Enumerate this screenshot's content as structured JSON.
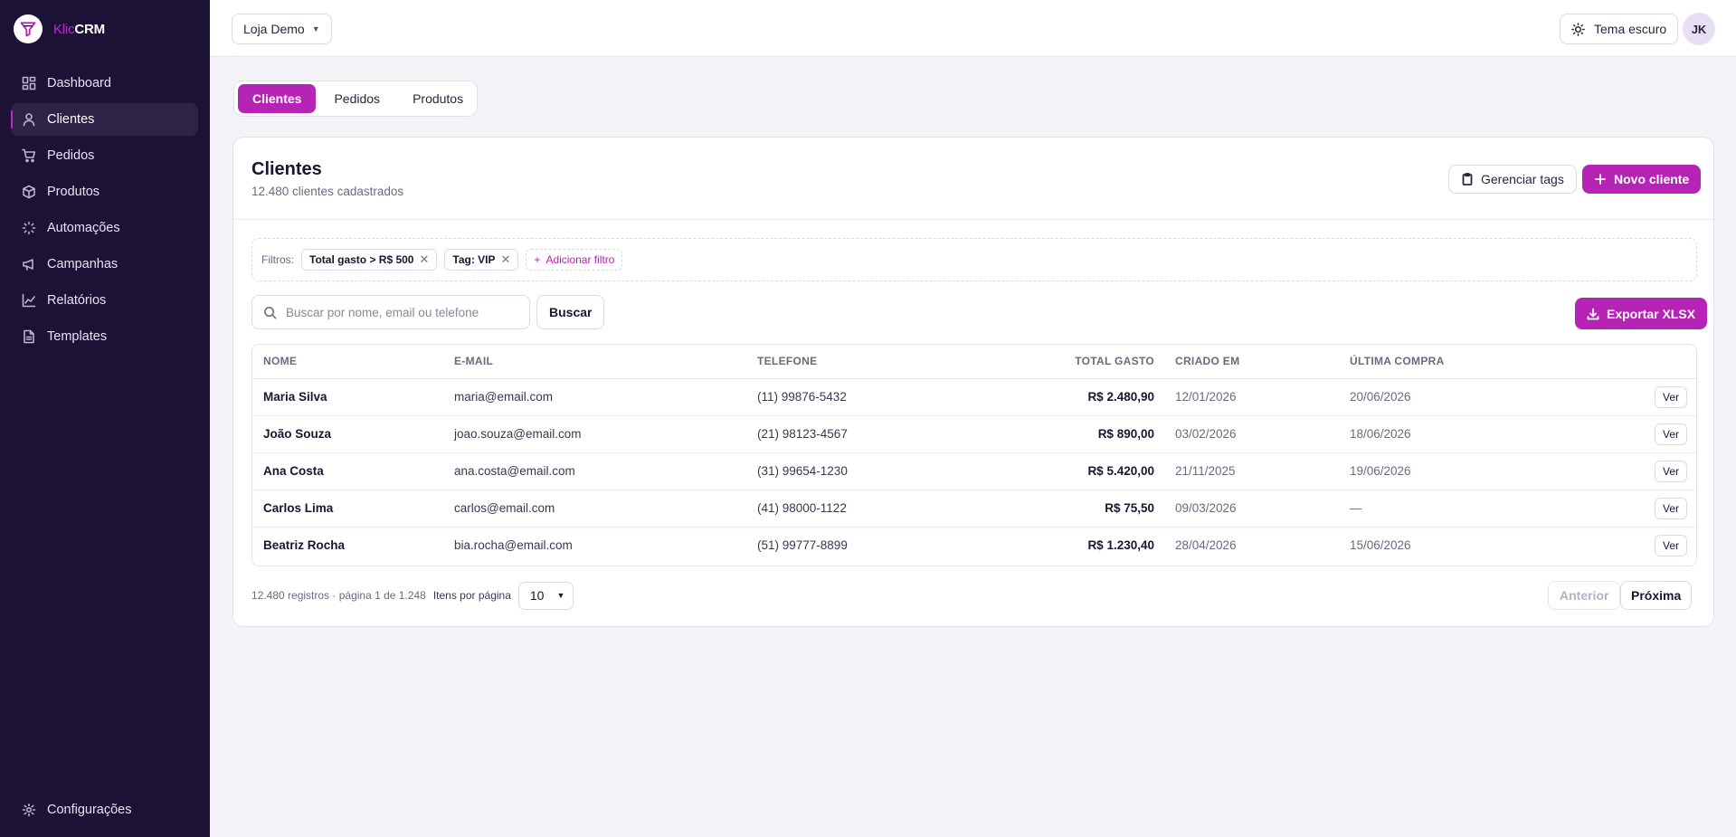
{
  "brand": {
    "prefix": "Klic",
    "suffix": "CRM"
  },
  "sidebar": {
    "items": [
      {
        "label": "Dashboard",
        "icon": "dashboard-icon"
      },
      {
        "label": "Clientes",
        "icon": "users-icon",
        "active": true
      },
      {
        "label": "Pedidos",
        "icon": "cart-icon"
      },
      {
        "label": "Produtos",
        "icon": "box-icon"
      },
      {
        "label": "Automações",
        "icon": "loader-icon"
      },
      {
        "label": "Campanhas",
        "icon": "megaphone-icon"
      },
      {
        "label": "Relatórios",
        "icon": "chart-icon"
      },
      {
        "label": "Templates",
        "icon": "file-icon"
      }
    ],
    "settings_label": "Configurações"
  },
  "topbar": {
    "store": "Loja Demo",
    "theme_label": "Tema escuro",
    "avatar_initials": "JK"
  },
  "tabs": [
    "Clientes",
    "Pedidos",
    "Produtos"
  ],
  "card": {
    "title": "Clientes",
    "subtitle": "12.480 clientes cadastrados",
    "manage_tags": "Gerenciar tags",
    "new_client": "Novo cliente"
  },
  "filters": {
    "label": "Filtros:",
    "chips": [
      "Total gasto > R$ 500",
      "Tag: VIP"
    ],
    "add_label": "Adicionar filtro"
  },
  "search": {
    "placeholder": "Buscar por nome, email ou telefone",
    "button": "Buscar",
    "export": "Exportar XLSX"
  },
  "table": {
    "headers": [
      "NOME",
      "E-MAIL",
      "TELEFONE",
      "TOTAL GASTO",
      "CRIADO EM",
      "ÚLTIMA COMPRA"
    ],
    "action_label": "Ver",
    "rows": [
      {
        "name": "Maria Silva",
        "email": "maria@email.com",
        "phone": "(11) 99876-5432",
        "total": "R$ 2.480,90",
        "created": "12/01/2026",
        "last": "20/06/2026"
      },
      {
        "name": "João Souza",
        "email": "joao.souza@email.com",
        "phone": "(21) 98123-4567",
        "total": "R$ 890,00",
        "created": "03/02/2026",
        "last": "18/06/2026"
      },
      {
        "name": "Ana Costa",
        "email": "ana.costa@email.com",
        "phone": "(31) 99654-1230",
        "total": "R$ 5.420,00",
        "created": "21/11/2025",
        "last": "19/06/2026"
      },
      {
        "name": "Carlos Lima",
        "email": "carlos@email.com",
        "phone": "(41) 98000-1122",
        "total": "R$ 75,50",
        "created": "09/03/2026",
        "last": "—"
      },
      {
        "name": "Beatriz Rocha",
        "email": "bia.rocha@email.com",
        "phone": "(51) 99777-8899",
        "total": "R$ 1.230,40",
        "created": "28/04/2026",
        "last": "15/06/2026"
      }
    ]
  },
  "pagination": {
    "info": "12.480 registros · página 1 de 1.248",
    "per_page_label": "Itens por página",
    "per_page": "10",
    "prev": "Anterior",
    "next": "Próxima"
  },
  "colors": {
    "accent": "#b624b5",
    "sidebar_bg": "#1c1236"
  }
}
